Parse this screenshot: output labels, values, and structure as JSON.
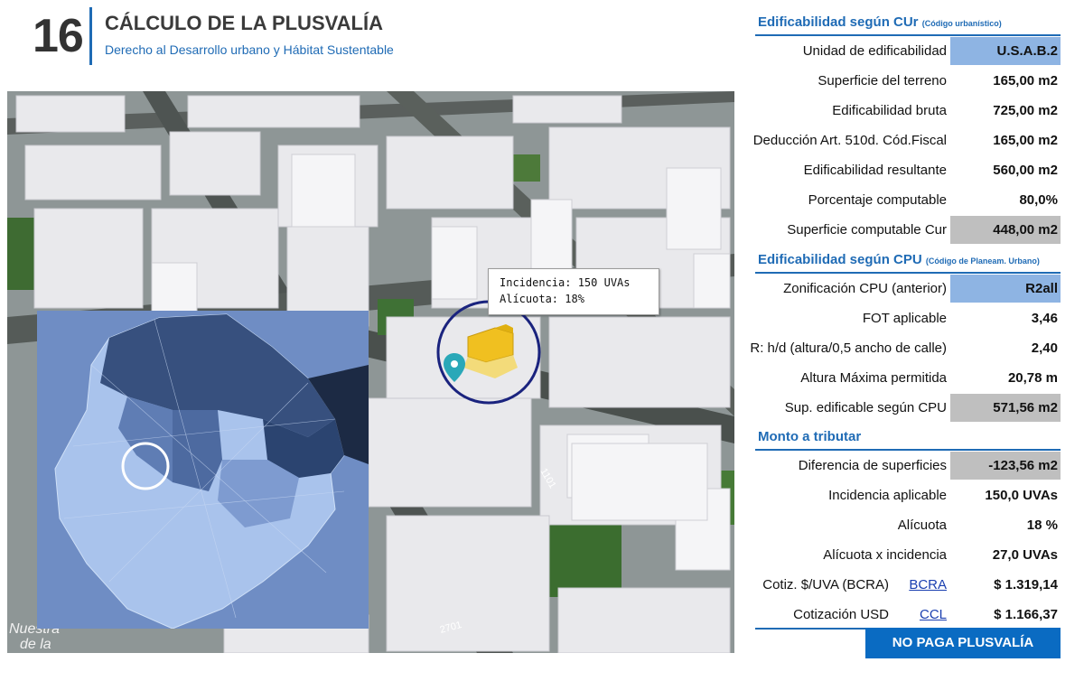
{
  "header": {
    "number": "16",
    "title": "CÁLCULO DE LA PLUSVALÍA",
    "subtitle": "Derecho al Desarrollo urbano y Hábitat Sustentable"
  },
  "map": {
    "tooltip_line1": "Incidencia: 150 UVAs",
    "tooltip_line2": "Alícuota: 18%",
    "street_label_1": "2701",
    "street_label_2": "1101",
    "corner_label_1": "Nuestra",
    "corner_label_2": "de la"
  },
  "sections": {
    "cur": {
      "title": "Edificabilidad según CUr",
      "subtitle": "(Código urbanístico)"
    },
    "cpu": {
      "title": "Edificabilidad según CPU",
      "subtitle": "(Código de Planeam. Urbano)"
    },
    "monto": {
      "title": "Monto a tributar"
    }
  },
  "rows": {
    "unidad": {
      "label": "Unidad de edificabilidad",
      "value": "U.S.A.B.2"
    },
    "superficie_terreno": {
      "label": "Superficie del terreno",
      "value": "165,00 m2"
    },
    "edif_bruta": {
      "label": "Edificabilidad bruta",
      "value": "725,00 m2"
    },
    "deduccion": {
      "label": "Deducción Art. 510d. Cód.Fiscal",
      "value": "165,00 m2"
    },
    "edif_resultante": {
      "label": "Edificabilidad resultante",
      "value": "560,00 m2"
    },
    "porcentaje": {
      "label": "Porcentaje computable",
      "value": "80,0%"
    },
    "sup_computable": {
      "label": "Superficie computable Cur",
      "value": "448,00 m2"
    },
    "zonificacion": {
      "label": "Zonificación CPU (anterior)",
      "value": "R2all"
    },
    "fot": {
      "label": "FOT aplicable",
      "value": "3,46"
    },
    "rhd": {
      "label": "R: h/d (altura/0,5 ancho de calle)",
      "value": "2,40"
    },
    "altura": {
      "label": "Altura Máxima permitida",
      "value": "20,78 m"
    },
    "sup_edificable": {
      "label": "Sup. edificable según CPU",
      "value": "571,56 m2"
    },
    "diferencia": {
      "label": "Diferencia de superficies",
      "value": "-123,56 m2"
    },
    "incidencia": {
      "label": "Incidencia aplicable",
      "value": "150,0 UVAs"
    },
    "alicuota": {
      "label": "Alícuota",
      "value": "18 %"
    },
    "alic_x_inc": {
      "label": "Alícuota x incidencia",
      "value": "27,0 UVAs"
    },
    "cotiz_uva": {
      "label": "Cotiz. $/UVA (BCRA)",
      "link": "BCRA",
      "value": "$ 1.319,14"
    },
    "cotiz_usd": {
      "label": "Cotización USD",
      "link": "CCL",
      "value": "$ 1.166,37"
    }
  },
  "result": {
    "label": "NO PAGA PLUSVALÍA"
  },
  "colors": {
    "accent": "#1f6bb5",
    "highlight_blue": "#8eb4e3",
    "highlight_gray": "#bfbfbf",
    "button": "#0a6bc2",
    "building": "#f0c020"
  }
}
